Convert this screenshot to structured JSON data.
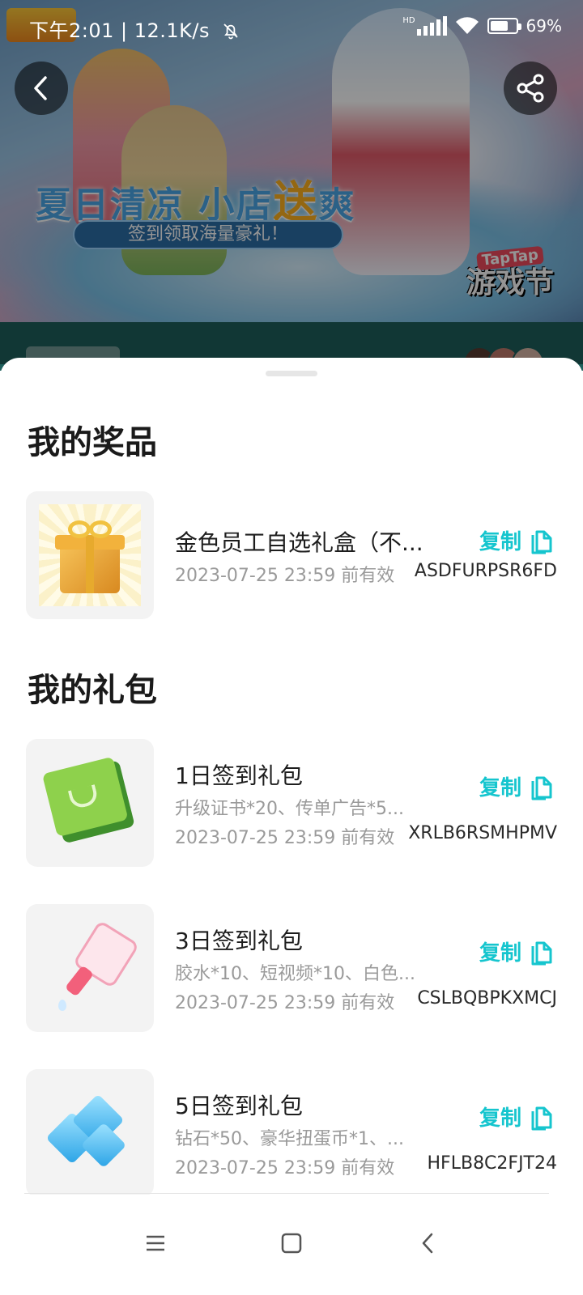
{
  "status_bar": {
    "time": "下午2:01 | 12.1K/s",
    "network_tag": "HD",
    "battery": "69%",
    "battery_level": 0.69
  },
  "banner": {
    "title_part1": "夏日清凉 小店",
    "title_highlight": "送",
    "title_part2": "爽",
    "subtitle": "签到领取海量豪礼！",
    "logo_top": "TapTap",
    "logo_bottom": "游戏节"
  },
  "sheet": {
    "prizes_title": "我的奖品",
    "gifts_title": "我的礼包",
    "copy_label": "复制",
    "prizes": [
      {
        "name": "金色员工自选礼盒（不...",
        "expiry": "2023-07-25 23:59 前有效",
        "code": "ASDFURPSR6FD",
        "icon": "gift-box"
      }
    ],
    "gifts": [
      {
        "name": "1日签到礼包",
        "desc": "升级证书*20、传单广告*5...",
        "expiry": "2023-07-25 23:59 前有效",
        "code": "XRLB6RSMHPMV",
        "icon": "green-scroll-book"
      },
      {
        "name": "3日签到礼包",
        "desc": "胶水*10、短视频*10、白色...",
        "expiry": "2023-07-25 23:59 前有效",
        "code": "CSLBQBPKXMCJ",
        "icon": "glue-bottle"
      },
      {
        "name": "5日签到礼包",
        "desc": "钻石*50、豪华扭蛋币*1、...",
        "expiry": "2023-07-25 23:59 前有效",
        "code": "HFLB8C2FJT24",
        "icon": "blue-diamonds"
      }
    ]
  },
  "colors": {
    "accent": "#15c5ce",
    "title_text": "#1a1a1a",
    "secondary_text": "#9a9a9a"
  }
}
